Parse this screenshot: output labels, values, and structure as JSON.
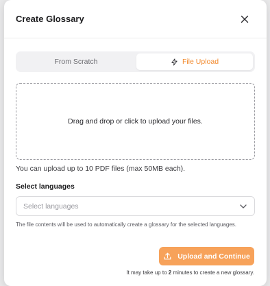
{
  "modal": {
    "title": "Create Glossary",
    "tabs": [
      {
        "label": "From Scratch",
        "active": false
      },
      {
        "label": "File Upload",
        "active": true
      }
    ],
    "dropzone_text": "Drag and drop or click to upload your files.",
    "upload_hint": "You can upload up to 10 PDF files (max 50MB each).",
    "languages": {
      "label": "Select languages",
      "placeholder": "Select languages"
    },
    "note": "The file contents will be used to automatically create a glossary for the selected languages.",
    "primary_button": "Upload and Continue",
    "footnote": {
      "prefix": "It may take up to ",
      "bold": "2",
      "suffix": " minutes to create a new glossary."
    }
  },
  "colors": {
    "accent": "#f28a2e",
    "primary_button_bg": "#f7a25a"
  },
  "icons": {
    "close": "close-icon",
    "tab_upload": "lightning-icon",
    "select_chevron": "chevron-down-icon",
    "button_upload": "upload-icon"
  }
}
